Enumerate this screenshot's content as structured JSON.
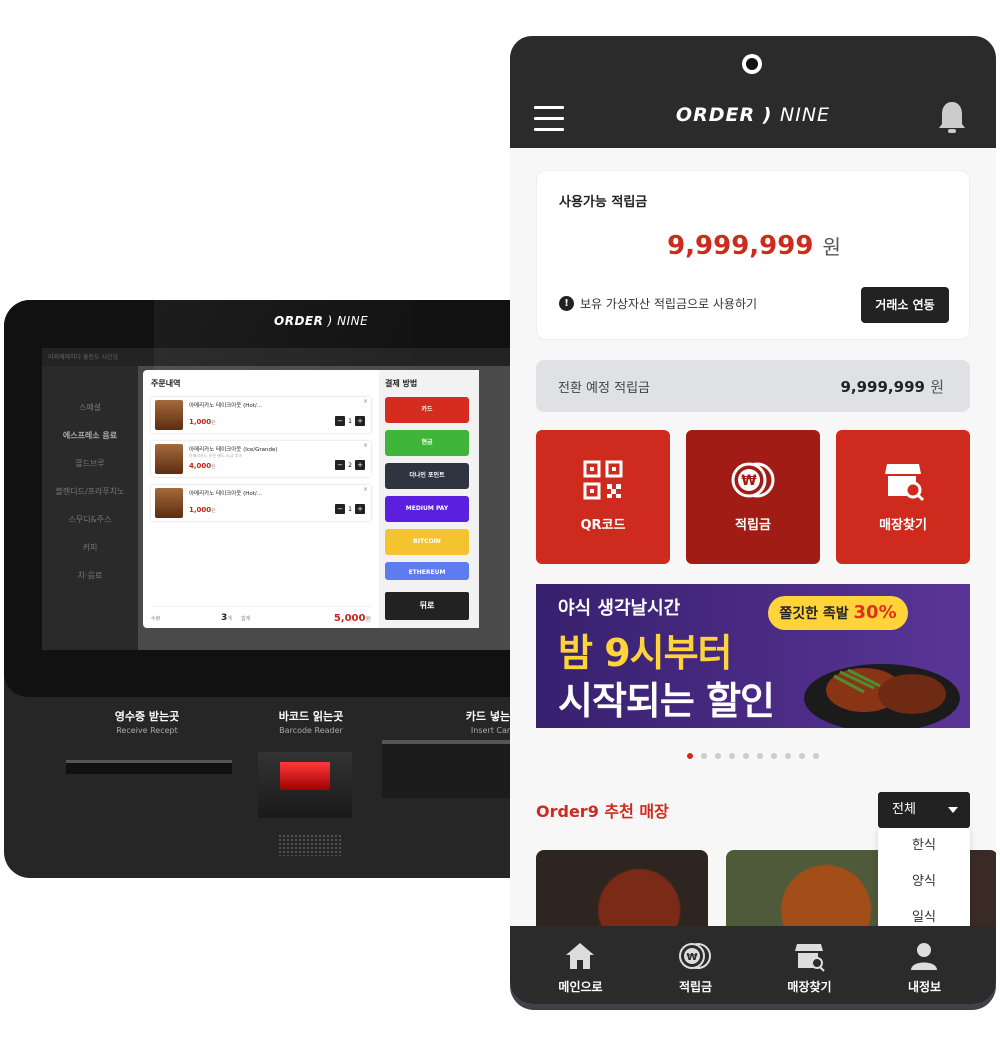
{
  "kiosk": {
    "logo_order": "ORDER",
    "logo_nine": "NINE",
    "top_text": "이외에에하다 흥진도 시간입",
    "sidebar": [
      "스페셜",
      "에스프레소 음료",
      "콜드브루",
      "블렌디드/프라푸치노",
      "스무디&주스",
      "커피",
      "차·음료"
    ],
    "modal": {
      "order_title": "주문내역",
      "payment_title": "결제 방법",
      "items": [
        {
          "name": "아메리카노 테이크아웃 (Hot/...",
          "sub": "",
          "price": "1,000",
          "won": "원",
          "qty": "1"
        },
        {
          "name": "아메리카노 테이크아웃 (Ice/Grande)",
          "sub": "아메리카노 숏은 별도 요금 부과",
          "price": "4,000",
          "won": "원",
          "qty": "2"
        },
        {
          "name": "아메리카노 테이크아웃 (Hot/...",
          "sub": "",
          "price": "1,000",
          "won": "원",
          "qty": "1"
        }
      ],
      "qty_label": "수량",
      "count": "3",
      "count_unit": "개",
      "sum_label": "합계",
      "total": "5,000",
      "total_unit": "원",
      "payments": [
        {
          "label": "카드",
          "color": "#d62b1f"
        },
        {
          "label": "현금",
          "color": "#3fb63a"
        },
        {
          "label": "더나인 포인트",
          "color": "#2e3440"
        },
        {
          "label": "MEDIUM PAY",
          "color": "#5b1fe0"
        },
        {
          "label": "BITCOIN",
          "color": "#f4c430"
        },
        {
          "label": "ETHEREUM",
          "color": "#5d7cf0"
        }
      ],
      "back_label": "뒤로"
    },
    "receipt": {
      "label": "영수증 받는곳",
      "sub": "Receive Recept"
    },
    "barcode": {
      "label": "바코드 읽는곳",
      "sub": "Barcode Reader"
    },
    "card": {
      "label": "카드 넣는곳",
      "sub": "Insert Card"
    }
  },
  "phone": {
    "logo_order": "ORDER",
    "logo_nine": "NINE",
    "icons": {
      "menu": "hamburger-icon",
      "bell": "bell-icon"
    },
    "balance": {
      "title": "사용가능 적립금",
      "amount": "9,999,999",
      "unit": "원",
      "note": "보유 가상자산 적립금으로 사용하기",
      "button": "거래소 연동"
    },
    "conversion": {
      "label": "전환 예정 적립금",
      "amount": "9,999,999",
      "unit": "원"
    },
    "tiles": [
      {
        "label": "QR코드",
        "icon": "qr-code-icon",
        "color": "#cf2a1e"
      },
      {
        "label": "적립금",
        "icon": "won-coin-icon",
        "color": "#a11c14"
      },
      {
        "label": "매장찾기",
        "icon": "store-search-icon",
        "color": "#cf2a1e"
      }
    ],
    "banner": {
      "line1": "야식 생각날시간",
      "line2": "밤 9시부터",
      "line3": "시작되는 할인",
      "pill_text": "쫄깃한 족발",
      "pill_pct": "30%"
    },
    "carousel": {
      "count": 10,
      "active": 0
    },
    "recommend": {
      "title": "Order9 추천 매장",
      "selected": "전체",
      "options": [
        "한식",
        "양식",
        "일식"
      ]
    },
    "nav": [
      {
        "label": "메인으로",
        "icon": "home-icon"
      },
      {
        "label": "적립금",
        "icon": "won-coin-icon"
      },
      {
        "label": "매장찾기",
        "icon": "store-search-icon"
      },
      {
        "label": "내정보",
        "icon": "user-icon"
      }
    ]
  }
}
